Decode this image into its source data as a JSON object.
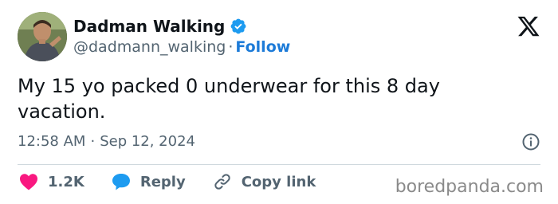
{
  "author": {
    "display_name": "Dadman Walking",
    "handle": "@dadmann_walking",
    "separator": "·",
    "follow_label": "Follow",
    "verified": true
  },
  "tweet": {
    "text": "My 15 yo packed 0 underwear for this 8 day vacation.",
    "time": "12:58 AM",
    "date_separator": "·",
    "date": "Sep 12, 2024"
  },
  "actions": {
    "like_count": "1.2K",
    "reply_label": "Reply",
    "copy_link_label": "Copy link"
  },
  "icons": {
    "brand": "x-logo-icon",
    "verified": "verified-badge-icon",
    "info": "info-icon",
    "like": "heart-icon",
    "reply": "speech-bubble-icon",
    "copy_link": "link-icon"
  },
  "colors": {
    "text_primary": "#0f1419",
    "text_secondary": "#536471",
    "link_blue": "#1d7bd8",
    "verified_blue": "#1d9bf0",
    "like_red": "#f91880",
    "divider": "#cfd9de"
  },
  "watermark": "boredpanda.com"
}
